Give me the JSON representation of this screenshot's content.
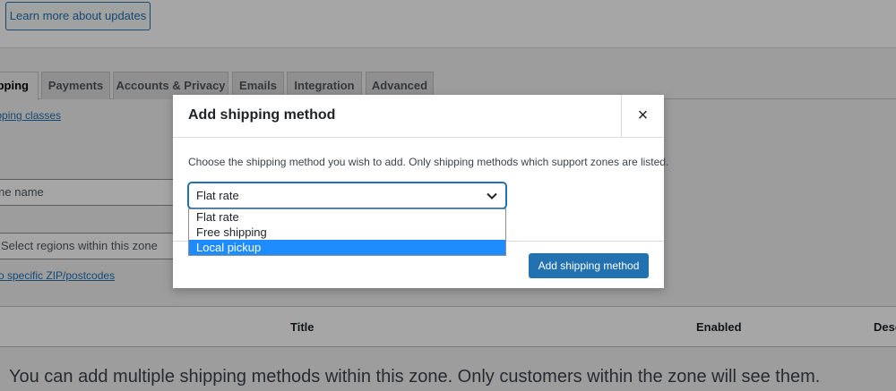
{
  "notice": {
    "learn_more_label": "Learn more about updates"
  },
  "tabs": [
    {
      "label": "Shipping"
    },
    {
      "label": "Payments"
    },
    {
      "label": "Accounts & Privacy"
    },
    {
      "label": "Emails"
    },
    {
      "label": "Integration"
    },
    {
      "label": "Advanced"
    }
  ],
  "page": {
    "shipping_classes_link": "Shipping classes",
    "zone_name_placeholder": "Zone name",
    "regions_placeholder": "Select regions within this zone",
    "limit_zip_link": "Limit to specific ZIP/postcodes",
    "table_headers": {
      "title": "Title",
      "enabled": "Enabled",
      "description": "Description"
    },
    "blank_message": "You can add multiple shipping methods within this zone. Only customers within the zone will see them."
  },
  "modal": {
    "title": "Add shipping method",
    "close_symbol": "×",
    "description": "Choose the shipping method you wish to add. Only shipping methods which support zones are listed.",
    "select": {
      "value": "Flat rate",
      "options": [
        {
          "label": "Flat rate",
          "highlighted": false
        },
        {
          "label": "Free shipping",
          "highlighted": false
        },
        {
          "label": "Local pickup",
          "highlighted": true
        }
      ]
    },
    "add_button_label": "Add shipping method"
  },
  "colors": {
    "primary": "#2271b1",
    "highlight": "#1e8cff",
    "overlay": "rgba(0,0,0,0.35)"
  },
  "icons": {
    "close": "close-icon",
    "select_arrow": "chevron-down-icon"
  }
}
